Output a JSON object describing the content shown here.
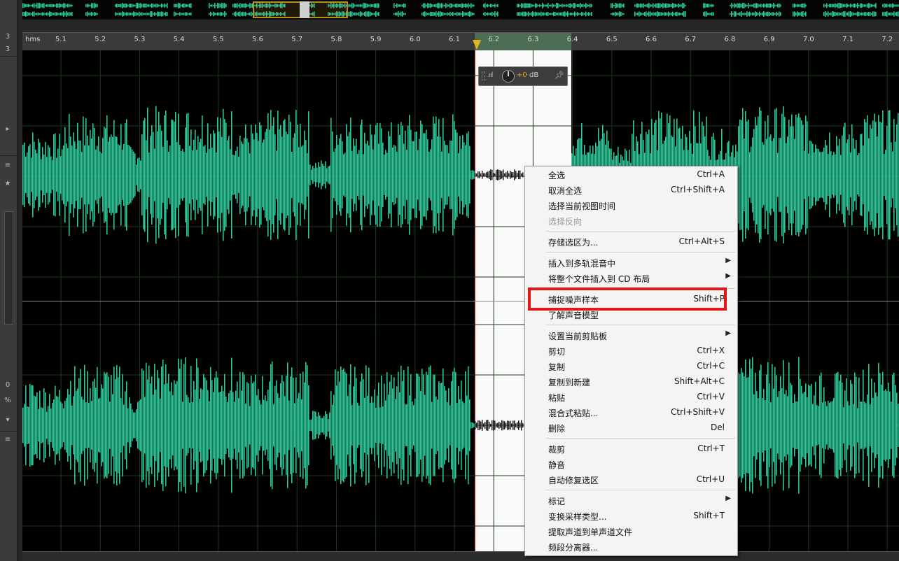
{
  "left_panel": {
    "items": [
      "3",
      "3"
    ],
    "time_readout": "0",
    "percent": "%"
  },
  "ruler": {
    "unit_label": "hms",
    "ticks": [
      "5.1",
      "5.2",
      "5.3",
      "5.4",
      "5.5",
      "5.6",
      "5.7",
      "5.8",
      "5.9",
      "6.0",
      "6.1",
      "6.2",
      "6.3",
      "6.4",
      "6.5",
      "6.6",
      "6.7",
      "6.8",
      "6.9",
      "7.0",
      "7.1",
      "7.2"
    ]
  },
  "hud": {
    "gain_value": "+0",
    "gain_unit": "dB"
  },
  "context_menu": {
    "groups": [
      [
        {
          "label": "全选",
          "shortcut": "Ctrl+A",
          "submenu": false,
          "disabled": false
        },
        {
          "label": "取消全选",
          "shortcut": "Ctrl+Shift+A",
          "submenu": false,
          "disabled": false
        },
        {
          "label": "选择当前视图时间",
          "shortcut": "",
          "submenu": false,
          "disabled": false
        },
        {
          "label": "选择反向",
          "shortcut": "",
          "submenu": false,
          "disabled": true
        }
      ],
      [
        {
          "label": "存储选区为...",
          "shortcut": "Ctrl+Alt+S",
          "submenu": false,
          "disabled": false
        }
      ],
      [
        {
          "label": "插入到多轨混音中",
          "shortcut": "",
          "submenu": true,
          "disabled": false
        },
        {
          "label": "将整个文件插入到 CD 布局",
          "shortcut": "",
          "submenu": true,
          "disabled": false
        }
      ],
      [
        {
          "label": "捕捉噪声样本",
          "shortcut": "Shift+P",
          "submenu": false,
          "disabled": false
        },
        {
          "label": "了解声音模型",
          "shortcut": "",
          "submenu": false,
          "disabled": false
        }
      ],
      [
        {
          "label": "设置当前剪贴板",
          "shortcut": "",
          "submenu": true,
          "disabled": false
        },
        {
          "label": "剪切",
          "shortcut": "Ctrl+X",
          "submenu": false,
          "disabled": false
        },
        {
          "label": "复制",
          "shortcut": "Ctrl+C",
          "submenu": false,
          "disabled": false
        },
        {
          "label": "复制到新建",
          "shortcut": "Shift+Alt+C",
          "submenu": false,
          "disabled": false
        },
        {
          "label": "粘贴",
          "shortcut": "Ctrl+V",
          "submenu": false,
          "disabled": false
        },
        {
          "label": "混合式粘贴...",
          "shortcut": "Ctrl+Shift+V",
          "submenu": false,
          "disabled": false
        },
        {
          "label": "删除",
          "shortcut": "Del",
          "submenu": false,
          "disabled": false
        }
      ],
      [
        {
          "label": "裁剪",
          "shortcut": "Ctrl+T",
          "submenu": false,
          "disabled": false
        },
        {
          "label": "静音",
          "shortcut": "",
          "submenu": false,
          "disabled": false
        },
        {
          "label": "自动修复选区",
          "shortcut": "Ctrl+U",
          "submenu": false,
          "disabled": false
        }
      ],
      [
        {
          "label": "标记",
          "shortcut": "",
          "submenu": true,
          "disabled": false
        },
        {
          "label": "变换采样类型...",
          "shortcut": "Shift+T",
          "submenu": false,
          "disabled": false
        },
        {
          "label": "提取声道到单声道文件",
          "shortcut": "",
          "submenu": false,
          "disabled": false
        },
        {
          "label": "频段分离器...",
          "shortcut": "",
          "submenu": false,
          "disabled": false
        }
      ]
    ],
    "highlighted_label": "捕捉噪声样本"
  },
  "colors": {
    "waveform": "#2fc79a",
    "selection_ruler": "#4d6e55",
    "highlight_box": "#e01818",
    "playhead": "#e5b320"
  }
}
